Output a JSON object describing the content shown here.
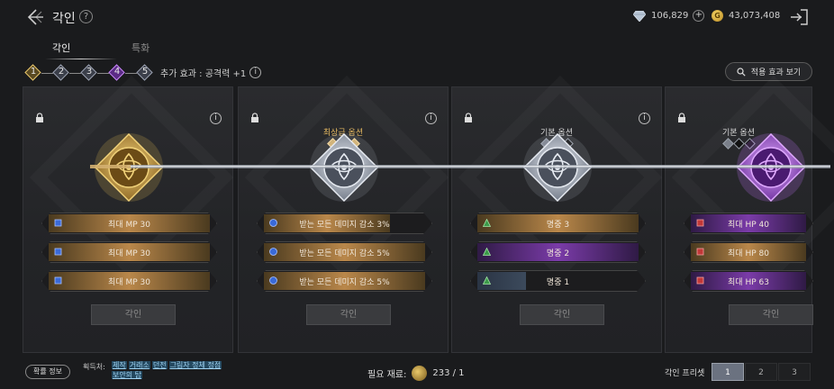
{
  "header": {
    "title": "각인",
    "currency_gem": "106,829",
    "currency_gold": "43,073,408"
  },
  "tabs": [
    {
      "label": "각인",
      "active": true
    },
    {
      "label": "특화",
      "active": false
    }
  ],
  "steps": [
    {
      "num": "1",
      "style": "gold"
    },
    {
      "num": "2",
      "style": "silver"
    },
    {
      "num": "3",
      "style": "silver"
    },
    {
      "num": "4",
      "style": "purple"
    },
    {
      "num": "5",
      "style": "silver"
    }
  ],
  "bonus_effect": "추가 효과 : 공격력 +1",
  "view_effects_label": "적용 효과 보기",
  "cards": [
    {
      "grade_label": "",
      "emblem": "gold",
      "options": [
        {
          "label": "최대 MP 30",
          "fill": 1.0,
          "color": "gold",
          "icon": "blue-square"
        },
        {
          "label": "최대 MP 30",
          "fill": 1.0,
          "color": "gold",
          "icon": "blue-square"
        },
        {
          "label": "최대 MP 30",
          "fill": 1.0,
          "color": "gold",
          "icon": "blue-square"
        }
      ],
      "button": "각인"
    },
    {
      "grade_label": "최상급 옵션",
      "pips": "gold",
      "emblem": "silver",
      "options": [
        {
          "label": "받는 모든 데미지 감소 3%",
          "fill": 0.78,
          "color": "gold",
          "icon": "blue-circle"
        },
        {
          "label": "받는 모든 데미지 감소 5%",
          "fill": 1.0,
          "color": "gold",
          "icon": "blue-circle"
        },
        {
          "label": "받는 모든 데미지 감소 5%",
          "fill": 1.0,
          "color": "gold",
          "icon": "blue-circle"
        }
      ],
      "button": "각인"
    },
    {
      "grade_label": "기본 옵션",
      "pips": "dark",
      "emblem": "silver",
      "options": [
        {
          "label": "명중 3",
          "fill": 1.0,
          "color": "gold",
          "icon": "green-triangle"
        },
        {
          "label": "명중 2",
          "fill": 1.0,
          "color": "purple",
          "icon": "green-triangle"
        },
        {
          "label": "명중 1",
          "fill": 0.3,
          "color": "steel",
          "icon": "green-triangle"
        }
      ],
      "button": "각인"
    },
    {
      "grade_label": "기본 옵션",
      "pips": "dark",
      "emblem": "purple",
      "options": [
        {
          "label": "최대 HP 40",
          "fill": 1.0,
          "color": "purple",
          "icon": "red-square"
        },
        {
          "label": "최대 HP 80",
          "fill": 1.0,
          "color": "gold",
          "icon": "red-square"
        },
        {
          "label": "최대 HP 63",
          "fill": 1.0,
          "color": "purple",
          "icon": "red-square"
        }
      ],
      "button": "각인"
    }
  ],
  "bottom": {
    "rate_info": "확률 정보",
    "source_label": "획득처:",
    "sources": [
      "제작",
      "거래소",
      "던전",
      "그림자 정체 정점",
      "보안의 탑"
    ],
    "material_label": "필요 재료:",
    "material_value": "233 / 1",
    "preset_label": "각인 프리셋",
    "presets": [
      "1",
      "2",
      "3"
    ],
    "active_preset": "1"
  },
  "colors": {
    "gold": "#b98a3e",
    "purple": "#7a3ba8",
    "steel": "#3c4a5c",
    "accent_blue": "#3a6ad8"
  }
}
